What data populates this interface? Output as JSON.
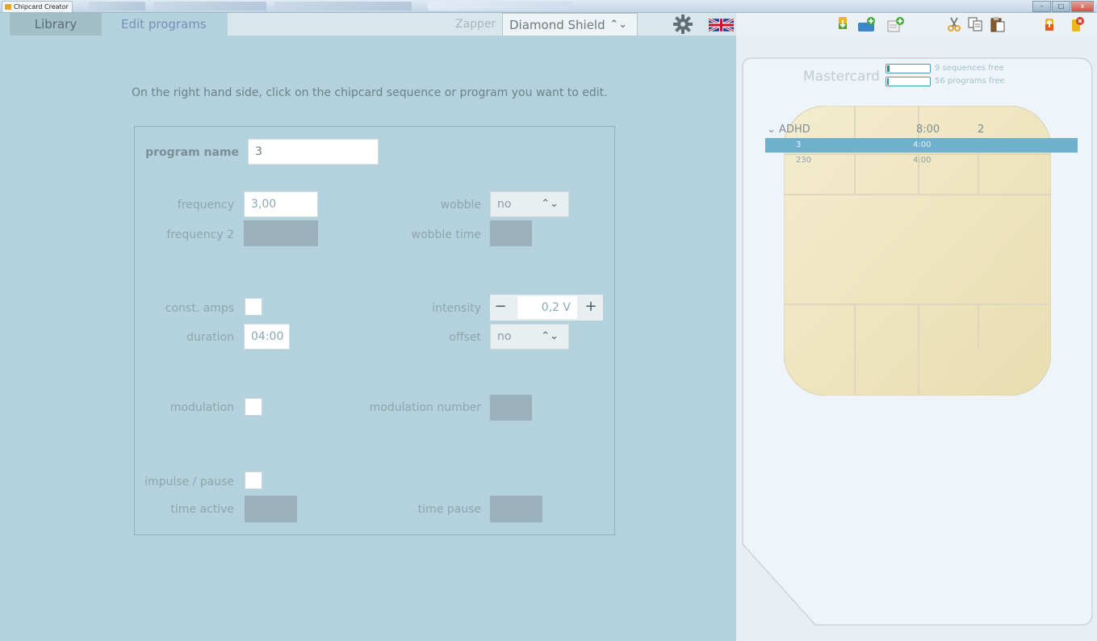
{
  "window": {
    "title": "Chipcard Creator"
  },
  "tabs": {
    "library": "Library",
    "edit_programs": "Edit programs"
  },
  "zapper": {
    "label": "Zapper",
    "selected": "Diamond Shield"
  },
  "instruction": "On the right hand side, click on the chipcard sequence or program you want to edit.",
  "form": {
    "program_name_label": "program name",
    "program_name_value": "3",
    "frequency_label": "frequency",
    "frequency_value": "3,00",
    "frequency2_label": "frequency 2",
    "wobble_label": "wobble",
    "wobble_value": "no",
    "wobble_time_label": "wobble time",
    "const_amps_label": "const. amps",
    "intensity_label": "intensity",
    "intensity_value": "0,2 V",
    "intensity_minus": "−",
    "intensity_plus": "+",
    "duration_label": "duration",
    "duration_value": "04:00",
    "offset_label": "offset",
    "offset_value": "no",
    "modulation_label": "modulation",
    "modulation_number_label": "modulation number",
    "impulse_pause_label": "impulse / pause",
    "time_active_label": "time active",
    "time_pause_label": "time pause"
  },
  "card": {
    "title": "Mastercard",
    "sequences_free": "9 sequences free",
    "programs_free": "56 programs free",
    "sequences_fill": 0.06,
    "programs_fill": 0.02,
    "sequence": {
      "name": "ADHD",
      "duration": "8:00",
      "count": "2"
    },
    "programs": [
      {
        "name": "3",
        "duration": "4:00",
        "selected": true
      },
      {
        "name": "230",
        "duration": "4:00",
        "selected": false
      }
    ]
  },
  "colors": {
    "accent": "#6fb1cc",
    "panel_bg": "#b3d2dd",
    "chip": "#efe6c3"
  }
}
